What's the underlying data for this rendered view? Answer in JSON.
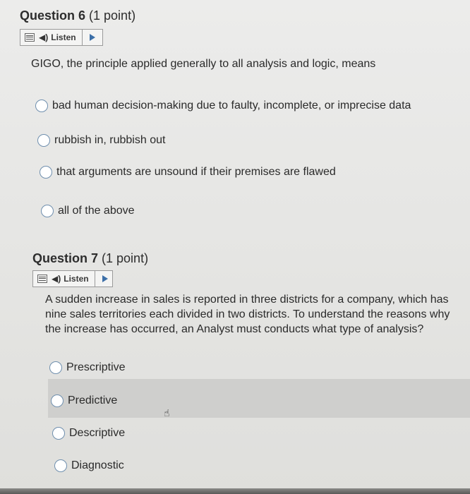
{
  "q6": {
    "number": "Question 6",
    "points": "(1 point)",
    "listen_label": "Listen",
    "prompt": "GIGO, the principle applied generally to all analysis and logic, means",
    "options": [
      "bad human decision-making due to faulty, incomplete, or imprecise data",
      "rubbish in, rubbish out",
      "that arguments are unsound if their premises are flawed",
      "all of the above"
    ]
  },
  "q7": {
    "number": "Question 7",
    "points": "(1 point)",
    "listen_label": "Listen",
    "prompt": "A sudden increase in sales is reported in three districts for a company, which has nine sales territories each divided in two districts. To understand the reasons why the increase has occurred, an Analyst must conducts what type of analysis?",
    "options": [
      "Prescriptive",
      "Predictive",
      "Descriptive",
      "Diagnostic"
    ]
  },
  "icons": {
    "speaker": "speaker-icon",
    "play": "play-icon",
    "menu": "menu-icon",
    "cursor": "hand-pointer-icon"
  }
}
